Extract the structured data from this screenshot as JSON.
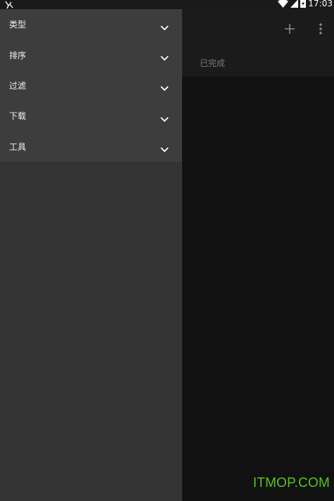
{
  "status_bar": {
    "time": "17:03",
    "icons": [
      "notification-icon",
      "wifi-icon",
      "signal-icon",
      "battery-charging-icon"
    ]
  },
  "app_bar": {
    "actions": [
      "add-icon",
      "more-vert-icon"
    ]
  },
  "tabs": [
    {
      "label": "已完成"
    }
  ],
  "drawer": {
    "items": [
      {
        "label": "类型",
        "icon": "chevron-down-icon"
      },
      {
        "label": "排序",
        "icon": "chevron-down-icon"
      },
      {
        "label": "过滤",
        "icon": "chevron-down-icon"
      },
      {
        "label": "下载",
        "icon": "chevron-down-icon"
      },
      {
        "label": "工具",
        "icon": "chevron-down-icon"
      }
    ]
  },
  "watermark": "ITMOP.COM",
  "colors": {
    "drawer_bg": "#333333",
    "menu_bg": "#3d3d3d",
    "app_bg": "#111111",
    "watermark": "#56c51f"
  }
}
